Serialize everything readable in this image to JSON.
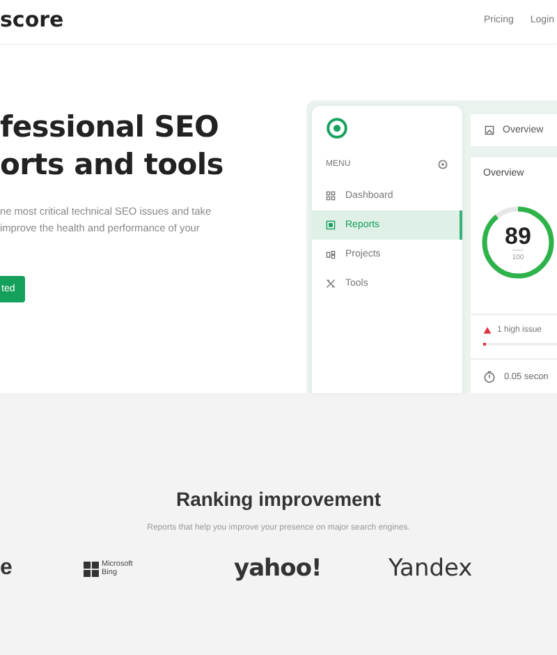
{
  "header": {
    "logo": "score",
    "nav": [
      "Pricing",
      "Login"
    ]
  },
  "hero": {
    "title_lines": [
      "fessional SEO",
      "orts and tools"
    ],
    "text_lines": [
      "ne most critical technical SEO issues and take",
      "improve the health and performance of your"
    ],
    "button": "ted"
  },
  "dashboard": {
    "menu_label": "MENU",
    "menu": [
      {
        "label": "Dashboard",
        "kind": "grid",
        "selected": false
      },
      {
        "label": "Reports",
        "kind": "report",
        "selected": true
      },
      {
        "label": "Projects",
        "kind": "projects",
        "selected": false
      },
      {
        "label": "Tools",
        "kind": "tools",
        "selected": false
      }
    ],
    "tab": "Overview",
    "card_title": "Overview",
    "score": "89",
    "score_max": "100",
    "level": 0.89,
    "issue": {
      "text": "1 high issue",
      "level": 0.03
    },
    "time": "0.05 secon"
  },
  "ranking": {
    "title": "Ranking improvement",
    "subtitle": "Reports that help you improve your presence on major search engines.",
    "logos": [
      {
        "kind": "plain",
        "text": "e"
      },
      {
        "kind": "bing",
        "lines": [
          "Microsoft",
          "Bing"
        ]
      },
      {
        "kind": "yahoo",
        "text": "yahoo!"
      },
      {
        "kind": "yandex",
        "text": "Yandex"
      }
    ]
  }
}
